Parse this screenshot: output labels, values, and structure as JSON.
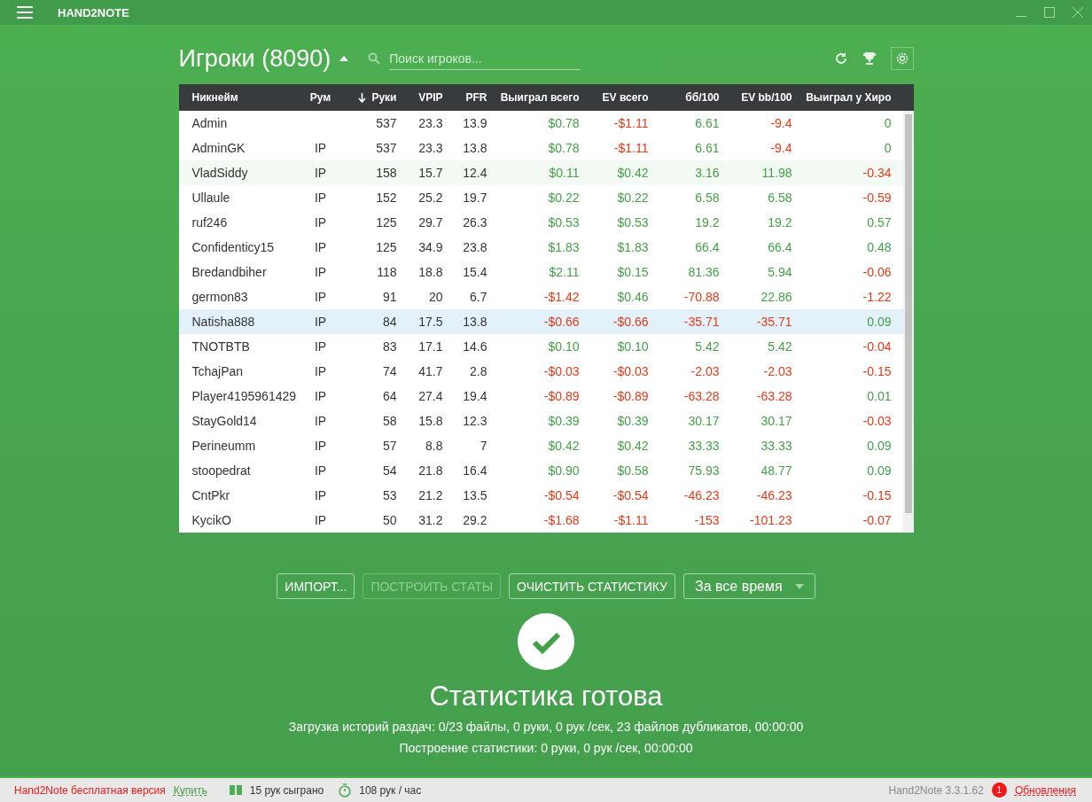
{
  "window": {
    "title": "HAND2NOTE"
  },
  "header": {
    "title": "Игроки (8090)",
    "search": {
      "placeholder": "Поиск игроков..."
    }
  },
  "table": {
    "columns": [
      {
        "label": "Никнейм",
        "sorted": false
      },
      {
        "label": "Рум",
        "sorted": false
      },
      {
        "label": "Руки",
        "sorted": true
      },
      {
        "label": "VPIP",
        "sorted": false
      },
      {
        "label": "PFR",
        "sorted": false
      },
      {
        "label": "Выиграл всего",
        "sorted": false
      },
      {
        "label": "EV всего",
        "sorted": false
      },
      {
        "label": "бб/100",
        "sorted": false
      },
      {
        "label": "EV bb/100",
        "sorted": false
      },
      {
        "label": "Выиграл у Хиро",
        "sorted": false
      }
    ],
    "rows": [
      {
        "selected": false,
        "hovered": false,
        "cells": [
          "Admin",
          "",
          "537",
          "23.3",
          "13.9"
        ],
        "money": [
          {
            "v": "$0.78",
            "loss": false
          },
          {
            "v": "-$1.11",
            "loss": true
          },
          {
            "v": "6.61",
            "loss": false
          },
          {
            "v": "-9.4",
            "loss": true
          },
          {
            "v": "0",
            "loss": false
          }
        ]
      },
      {
        "selected": false,
        "hovered": false,
        "cells": [
          "AdminGK",
          "IP",
          "537",
          "23.3",
          "13.8"
        ],
        "money": [
          {
            "v": "$0.78",
            "loss": false
          },
          {
            "v": "-$1.11",
            "loss": true
          },
          {
            "v": "6.61",
            "loss": false
          },
          {
            "v": "-9.4",
            "loss": true
          },
          {
            "v": "0",
            "loss": false
          }
        ]
      },
      {
        "selected": false,
        "hovered": true,
        "cells": [
          "VladSiddy",
          "IP",
          "158",
          "15.7",
          "12.4"
        ],
        "money": [
          {
            "v": "$0.11",
            "loss": false
          },
          {
            "v": "$0.42",
            "loss": false
          },
          {
            "v": "3.16",
            "loss": false
          },
          {
            "v": "11.98",
            "loss": false
          },
          {
            "v": "-0.34",
            "loss": true
          }
        ]
      },
      {
        "selected": false,
        "hovered": false,
        "cells": [
          "Ullaule",
          "IP",
          "152",
          "25.2",
          "19.7"
        ],
        "money": [
          {
            "v": "$0.22",
            "loss": false
          },
          {
            "v": "$0.22",
            "loss": false
          },
          {
            "v": "6.58",
            "loss": false
          },
          {
            "v": "6.58",
            "loss": false
          },
          {
            "v": "-0.59",
            "loss": true
          }
        ]
      },
      {
        "selected": false,
        "hovered": false,
        "cells": [
          "ruf246",
          "IP",
          "125",
          "29.7",
          "26.3"
        ],
        "money": [
          {
            "v": "$0.53",
            "loss": false
          },
          {
            "v": "$0.53",
            "loss": false
          },
          {
            "v": "19.2",
            "loss": false
          },
          {
            "v": "19.2",
            "loss": false
          },
          {
            "v": "0.57",
            "loss": false
          }
        ]
      },
      {
        "selected": false,
        "hovered": false,
        "cells": [
          "Confidenticy15",
          "IP",
          "125",
          "34.9",
          "23.8"
        ],
        "money": [
          {
            "v": "$1.83",
            "loss": false
          },
          {
            "v": "$1.83",
            "loss": false
          },
          {
            "v": "66.4",
            "loss": false
          },
          {
            "v": "66.4",
            "loss": false
          },
          {
            "v": "0.48",
            "loss": false
          }
        ]
      },
      {
        "selected": false,
        "hovered": false,
        "cells": [
          "Bredandbiher",
          "IP",
          "118",
          "18.8",
          "15.4"
        ],
        "money": [
          {
            "v": "$2.11",
            "loss": false
          },
          {
            "v": "$0.15",
            "loss": false
          },
          {
            "v": "81.36",
            "loss": false
          },
          {
            "v": "5.94",
            "loss": false
          },
          {
            "v": "-0.06",
            "loss": true
          }
        ]
      },
      {
        "selected": false,
        "hovered": false,
        "cells": [
          "germon83",
          "IP",
          "91",
          "20",
          "6.7"
        ],
        "money": [
          {
            "v": "-$1.42",
            "loss": true
          },
          {
            "v": "$0.46",
            "loss": false
          },
          {
            "v": "-70.88",
            "loss": true
          },
          {
            "v": "22.86",
            "loss": false
          },
          {
            "v": "-1.22",
            "loss": true
          }
        ]
      },
      {
        "selected": true,
        "hovered": false,
        "cells": [
          "Natisha888",
          "IP",
          "84",
          "17.5",
          "13.8"
        ],
        "money": [
          {
            "v": "-$0.66",
            "loss": true
          },
          {
            "v": "-$0.66",
            "loss": true
          },
          {
            "v": "-35.71",
            "loss": true
          },
          {
            "v": "-35.71",
            "loss": true
          },
          {
            "v": "0.09",
            "loss": false
          }
        ]
      },
      {
        "selected": false,
        "hovered": false,
        "cells": [
          "TNOTBTB",
          "IP",
          "83",
          "17.1",
          "14.6"
        ],
        "money": [
          {
            "v": "$0.10",
            "loss": false
          },
          {
            "v": "$0.10",
            "loss": false
          },
          {
            "v": "5.42",
            "loss": false
          },
          {
            "v": "5.42",
            "loss": false
          },
          {
            "v": "-0.04",
            "loss": true
          }
        ]
      },
      {
        "selected": false,
        "hovered": false,
        "cells": [
          "TchajPan",
          "IP",
          "74",
          "41.7",
          "2.8"
        ],
        "money": [
          {
            "v": "-$0.03",
            "loss": true
          },
          {
            "v": "-$0.03",
            "loss": true
          },
          {
            "v": "-2.03",
            "loss": true
          },
          {
            "v": "-2.03",
            "loss": true
          },
          {
            "v": "-0.15",
            "loss": true
          }
        ]
      },
      {
        "selected": false,
        "hovered": false,
        "cells": [
          "Player4195961429",
          "IP",
          "64",
          "27.4",
          "19.4"
        ],
        "money": [
          {
            "v": "-$0.89",
            "loss": true
          },
          {
            "v": "-$0.89",
            "loss": true
          },
          {
            "v": "-63.28",
            "loss": true
          },
          {
            "v": "-63.28",
            "loss": true
          },
          {
            "v": "0.01",
            "loss": false
          }
        ]
      },
      {
        "selected": false,
        "hovered": false,
        "cells": [
          "StayGold14",
          "IP",
          "58",
          "15.8",
          "12.3"
        ],
        "money": [
          {
            "v": "$0.39",
            "loss": false
          },
          {
            "v": "$0.39",
            "loss": false
          },
          {
            "v": "30.17",
            "loss": false
          },
          {
            "v": "30.17",
            "loss": false
          },
          {
            "v": "-0.03",
            "loss": true
          }
        ]
      },
      {
        "selected": false,
        "hovered": false,
        "cells": [
          "Perineumm",
          "IP",
          "57",
          "8.8",
          "7"
        ],
        "money": [
          {
            "v": "$0.42",
            "loss": false
          },
          {
            "v": "$0.42",
            "loss": false
          },
          {
            "v": "33.33",
            "loss": false
          },
          {
            "v": "33.33",
            "loss": false
          },
          {
            "v": "0.09",
            "loss": false
          }
        ]
      },
      {
        "selected": false,
        "hovered": false,
        "cells": [
          "stoopedrat",
          "IP",
          "54",
          "21.8",
          "16.4"
        ],
        "money": [
          {
            "v": "$0.90",
            "loss": false
          },
          {
            "v": "$0.58",
            "loss": false
          },
          {
            "v": "75.93",
            "loss": false
          },
          {
            "v": "48.77",
            "loss": false
          },
          {
            "v": "0.09",
            "loss": false
          }
        ]
      },
      {
        "selected": false,
        "hovered": false,
        "cells": [
          "CntPkr",
          "IP",
          "53",
          "21.2",
          "13.5"
        ],
        "money": [
          {
            "v": "-$0.54",
            "loss": true
          },
          {
            "v": "-$0.54",
            "loss": true
          },
          {
            "v": "-46.23",
            "loss": true
          },
          {
            "v": "-46.23",
            "loss": true
          },
          {
            "v": "-0.15",
            "loss": true
          }
        ]
      },
      {
        "selected": false,
        "hovered": false,
        "cells": [
          "KycikO",
          "IP",
          "50",
          "31.2",
          "29.2"
        ],
        "money": [
          {
            "v": "-$1.68",
            "loss": true
          },
          {
            "v": "-$1.11",
            "loss": true
          },
          {
            "v": "-153",
            "loss": true
          },
          {
            "v": "-101.23",
            "loss": true
          },
          {
            "v": "-0.07",
            "loss": true
          }
        ]
      }
    ]
  },
  "actions": [
    {
      "label": "ИМПОРТ...",
      "kind": "button",
      "disabled": false
    },
    {
      "label": "ПОСТРОИТЬ СТАТЫ",
      "kind": "button",
      "disabled": true
    },
    {
      "label": "ОЧИСТИТЬ СТАТИСТИКУ",
      "kind": "button",
      "disabled": false
    },
    {
      "label": "За все время",
      "kind": "dropdown",
      "disabled": false
    }
  ],
  "status": {
    "title": "Статистика готова",
    "lines": [
      "Загрузка историй раздач: 0/23 файлы, 0 руки, 0 рук /сек, 23 файлов дубликатов, 00:00:00",
      "Построение статистики: 0 руки, 0 рук /сек, 00:00:00"
    ]
  },
  "status_bar": {
    "edition": "Hand2Note бесплатная версия",
    "buy": "Купить",
    "played": "15 рук сыграно",
    "rate": "108 рук / час",
    "version": "Hand2Note 3.3.1.62",
    "updates_count": "1",
    "updates": "Обновления"
  }
}
